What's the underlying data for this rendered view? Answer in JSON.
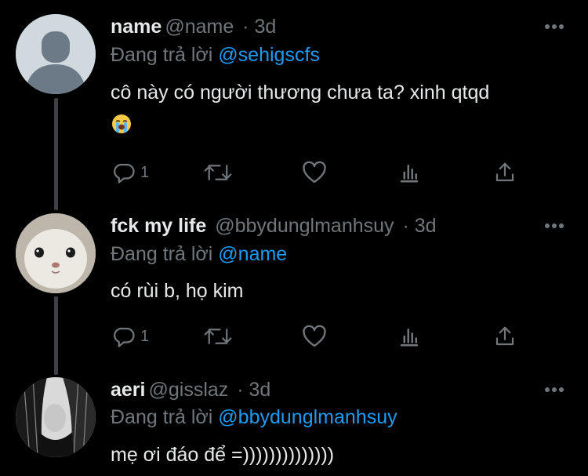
{
  "tweets": [
    {
      "name": "name",
      "handle": "@name",
      "time": "3d",
      "replying_prefix": "Đang trả lời",
      "replying_to": "@sehigscfs",
      "text": "cô này có người thương chưa ta? xinh qtqd",
      "emoji": "loudly-crying-face",
      "reply_count": "1",
      "avatar": "default-avatar"
    },
    {
      "name": "fck my life",
      "handle": "@bbydunglmanhsuy",
      "time": "3d",
      "replying_prefix": "Đang trả lời",
      "replying_to": "@name",
      "text": "có rùi b, họ kim",
      "reply_count": "1",
      "avatar": "cat-avatar"
    },
    {
      "name": "aeri",
      "handle": "@gisslaz",
      "time": "3d",
      "replying_prefix": "Đang trả lời",
      "replying_to": "@bbydunglmanhsuy",
      "text": "mẹ ơi đáo để =))))))))))))))",
      "avatar": "dark-hair-avatar"
    }
  ],
  "colors": {
    "background": "#000000",
    "text": "#e7e9ea",
    "muted": "#71767b",
    "accent": "#1d9bf0",
    "thread_line": "#3e4144"
  }
}
